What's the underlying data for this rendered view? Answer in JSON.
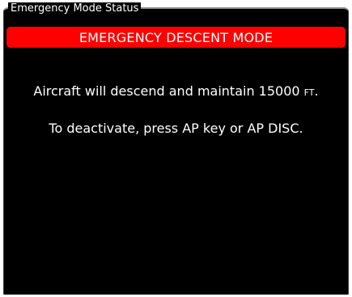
{
  "panel": {
    "title": "Emergency Mode Status"
  },
  "banner": {
    "text": "EMERGENCY DESCENT MODE",
    "color": "#ff0000"
  },
  "message": {
    "line1_text": "Aircraft will descend and maintain ",
    "altitude": "15000",
    "altitude_unit": "FT",
    "line1_end": ".",
    "line2_text": "To deactivate, press AP key or AP DISC."
  }
}
